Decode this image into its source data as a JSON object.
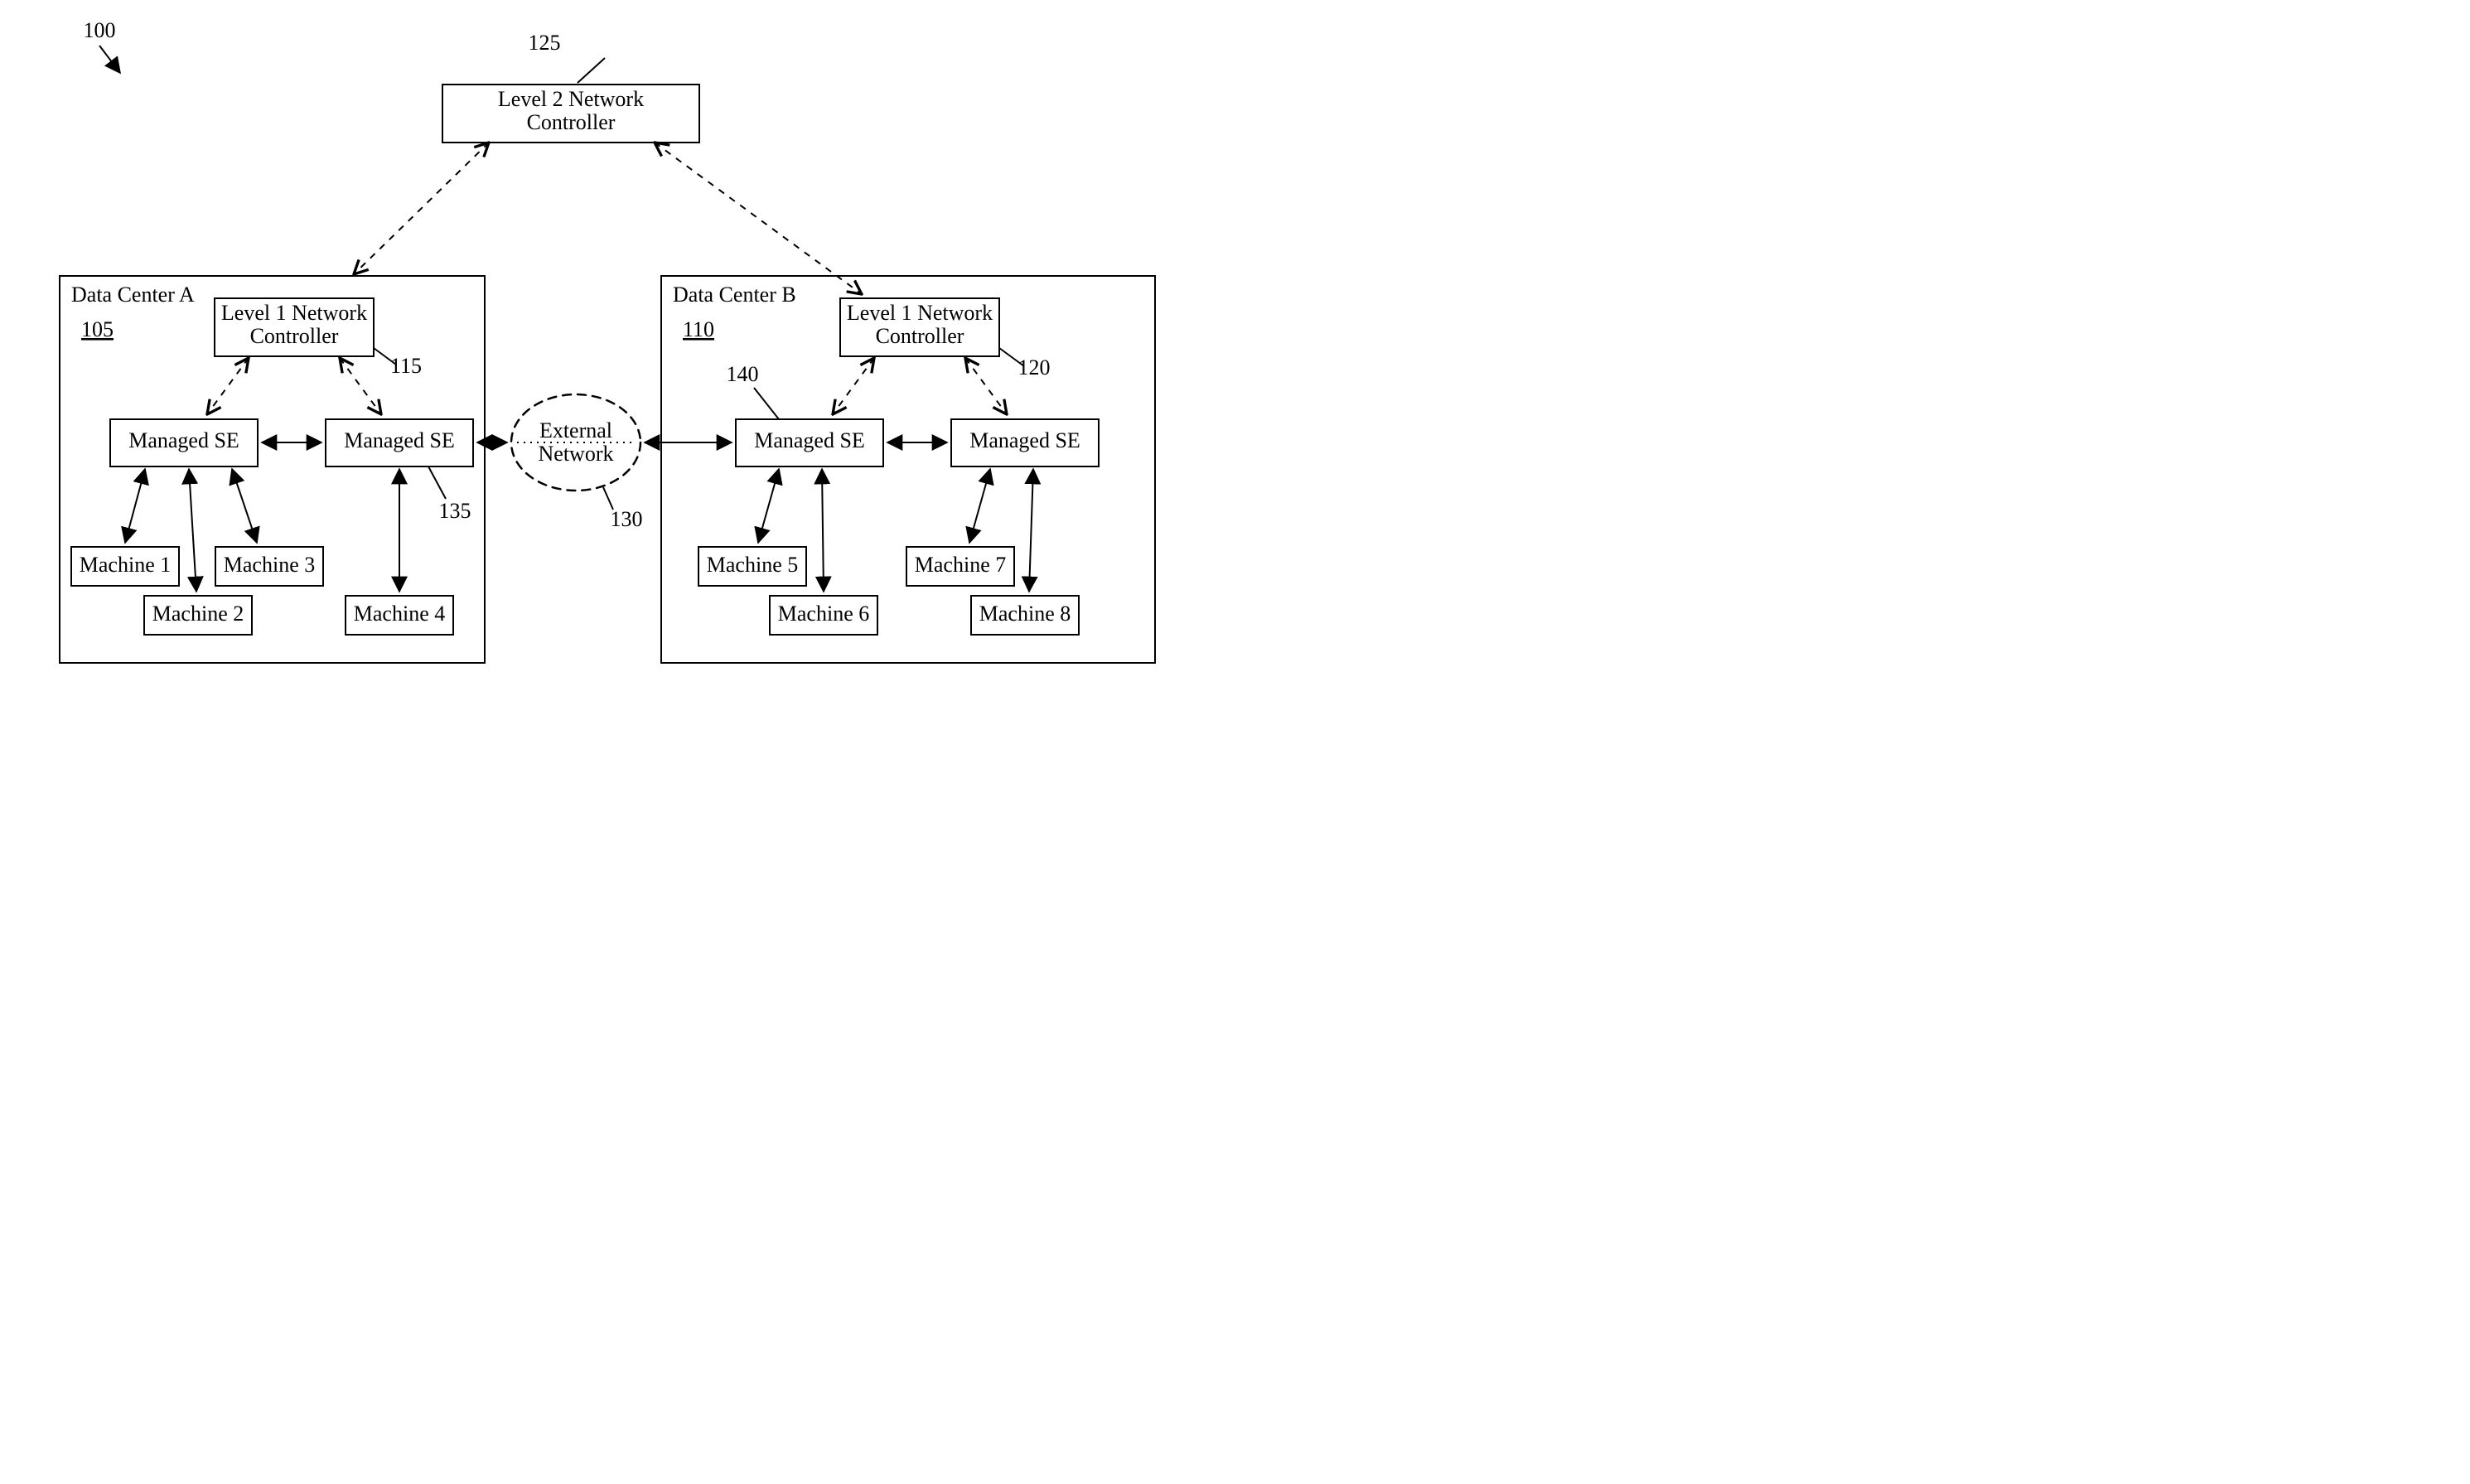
{
  "figure_ref": "100",
  "l2_controller": {
    "l1": "Level 2 Network",
    "l2": "Controller",
    "ref": "125"
  },
  "external_network": {
    "l1": "External",
    "l2": "Network",
    "ref": "130"
  },
  "dc_a": {
    "title": "Data Center A",
    "ref": "105",
    "l1_controller": {
      "l1": "Level 1 Network",
      "l2": "Controller",
      "ref": "115"
    },
    "se_left": "Managed SE",
    "se_right": "Managed SE",
    "se_right_ref": "135",
    "m1": "Machine 1",
    "m2": "Machine 2",
    "m3": "Machine 3",
    "m4": "Machine 4"
  },
  "dc_b": {
    "title": "Data Center B",
    "ref": "110",
    "l1_controller": {
      "l1": "Level 1 Network",
      "l2": "Controller",
      "ref": "120"
    },
    "se_left": "Managed SE",
    "se_left_ref": "140",
    "se_right": "Managed SE",
    "m5": "Machine 5",
    "m6": "Machine 6",
    "m7": "Machine 7",
    "m8": "Machine 8"
  }
}
